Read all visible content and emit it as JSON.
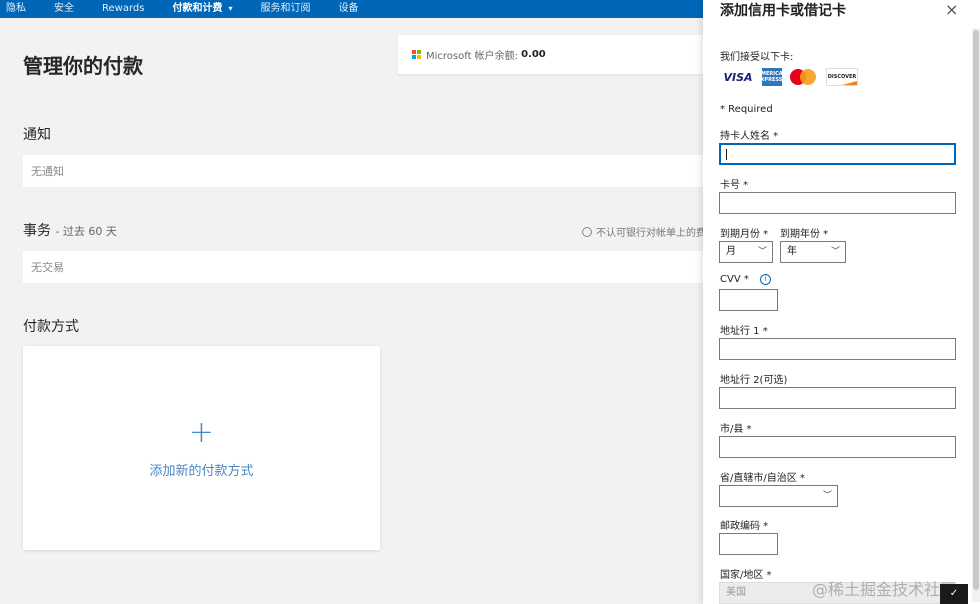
{
  "nav": {
    "items": [
      {
        "label": "隐私"
      },
      {
        "label": "安全"
      },
      {
        "label": "Rewards"
      },
      {
        "label": "付款和计费",
        "active": true
      },
      {
        "label": "服务和订阅"
      },
      {
        "label": "设备"
      }
    ]
  },
  "main": {
    "title": "管理你的付款",
    "balance": {
      "label": "Microsoft 帐户余额:",
      "amount": "0.00"
    },
    "notifications": {
      "title": "通知",
      "empty": "无通知"
    },
    "transactions": {
      "title": "事务",
      "subtitle": "- 过去 60 天",
      "empty": "无交易",
      "dispute_text": "不认可银行对帐单上的费"
    },
    "payment": {
      "title": "付款方式",
      "add_plus": "+",
      "add_label": "添加新的付款方式"
    }
  },
  "panel": {
    "title": "添加信用卡或借记卡",
    "close": "×",
    "accept_label": "我们接受以下卡:",
    "cards": {
      "visa": "VISA",
      "amex": "AMERICAN EXPRESS",
      "discover": "DISCOVER"
    },
    "required_note": "* Required",
    "fields": {
      "name": {
        "label": "持卡人姓名 *",
        "value": ""
      },
      "number": {
        "label": "卡号 *",
        "value": ""
      },
      "exp_month": {
        "label": "到期月份 *",
        "value": "月"
      },
      "exp_year": {
        "label": "到期年份 *",
        "value": "年"
      },
      "cvv": {
        "label": "CVV *",
        "value": ""
      },
      "address1": {
        "label": "地址行 1 *",
        "value": ""
      },
      "address2": {
        "label": "地址行 2(可选)",
        "value": ""
      },
      "city": {
        "label": "市/县 *",
        "value": ""
      },
      "province": {
        "label": "省/直辖市/自治区 *",
        "value": ""
      },
      "postal": {
        "label": "邮政编码 *",
        "value": ""
      },
      "country": {
        "label": "国家/地区 *",
        "value": "美国"
      }
    }
  },
  "watermark": "@稀土掘金技术社区",
  "colors": {
    "nav_bg": "#0067b8",
    "accent": "#4a86c5",
    "focus": "#0067b8"
  },
  "icons": {
    "close": "close-icon",
    "chevron": "chevron-down-icon",
    "info": "info-icon",
    "plus": "plus-icon"
  }
}
